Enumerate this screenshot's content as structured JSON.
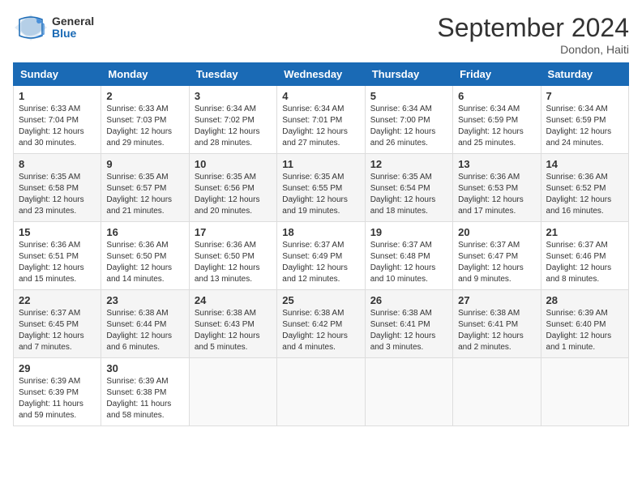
{
  "logo": {
    "general": "General",
    "blue": "Blue"
  },
  "title": "September 2024",
  "location": "Dondon, Haiti",
  "days_of_week": [
    "Sunday",
    "Monday",
    "Tuesday",
    "Wednesday",
    "Thursday",
    "Friday",
    "Saturday"
  ],
  "weeks": [
    [
      {
        "day": "1",
        "info": "Sunrise: 6:33 AM\nSunset: 7:04 PM\nDaylight: 12 hours and 30 minutes."
      },
      {
        "day": "2",
        "info": "Sunrise: 6:33 AM\nSunset: 7:03 PM\nDaylight: 12 hours and 29 minutes."
      },
      {
        "day": "3",
        "info": "Sunrise: 6:34 AM\nSunset: 7:02 PM\nDaylight: 12 hours and 28 minutes."
      },
      {
        "day": "4",
        "info": "Sunrise: 6:34 AM\nSunset: 7:01 PM\nDaylight: 12 hours and 27 minutes."
      },
      {
        "day": "5",
        "info": "Sunrise: 6:34 AM\nSunset: 7:00 PM\nDaylight: 12 hours and 26 minutes."
      },
      {
        "day": "6",
        "info": "Sunrise: 6:34 AM\nSunset: 6:59 PM\nDaylight: 12 hours and 25 minutes."
      },
      {
        "day": "7",
        "info": "Sunrise: 6:34 AM\nSunset: 6:59 PM\nDaylight: 12 hours and 24 minutes."
      }
    ],
    [
      {
        "day": "8",
        "info": "Sunrise: 6:35 AM\nSunset: 6:58 PM\nDaylight: 12 hours and 23 minutes."
      },
      {
        "day": "9",
        "info": "Sunrise: 6:35 AM\nSunset: 6:57 PM\nDaylight: 12 hours and 21 minutes."
      },
      {
        "day": "10",
        "info": "Sunrise: 6:35 AM\nSunset: 6:56 PM\nDaylight: 12 hours and 20 minutes."
      },
      {
        "day": "11",
        "info": "Sunrise: 6:35 AM\nSunset: 6:55 PM\nDaylight: 12 hours and 19 minutes."
      },
      {
        "day": "12",
        "info": "Sunrise: 6:35 AM\nSunset: 6:54 PM\nDaylight: 12 hours and 18 minutes."
      },
      {
        "day": "13",
        "info": "Sunrise: 6:36 AM\nSunset: 6:53 PM\nDaylight: 12 hours and 17 minutes."
      },
      {
        "day": "14",
        "info": "Sunrise: 6:36 AM\nSunset: 6:52 PM\nDaylight: 12 hours and 16 minutes."
      }
    ],
    [
      {
        "day": "15",
        "info": "Sunrise: 6:36 AM\nSunset: 6:51 PM\nDaylight: 12 hours and 15 minutes."
      },
      {
        "day": "16",
        "info": "Sunrise: 6:36 AM\nSunset: 6:50 PM\nDaylight: 12 hours and 14 minutes."
      },
      {
        "day": "17",
        "info": "Sunrise: 6:36 AM\nSunset: 6:50 PM\nDaylight: 12 hours and 13 minutes."
      },
      {
        "day": "18",
        "info": "Sunrise: 6:37 AM\nSunset: 6:49 PM\nDaylight: 12 hours and 12 minutes."
      },
      {
        "day": "19",
        "info": "Sunrise: 6:37 AM\nSunset: 6:48 PM\nDaylight: 12 hours and 10 minutes."
      },
      {
        "day": "20",
        "info": "Sunrise: 6:37 AM\nSunset: 6:47 PM\nDaylight: 12 hours and 9 minutes."
      },
      {
        "day": "21",
        "info": "Sunrise: 6:37 AM\nSunset: 6:46 PM\nDaylight: 12 hours and 8 minutes."
      }
    ],
    [
      {
        "day": "22",
        "info": "Sunrise: 6:37 AM\nSunset: 6:45 PM\nDaylight: 12 hours and 7 minutes."
      },
      {
        "day": "23",
        "info": "Sunrise: 6:38 AM\nSunset: 6:44 PM\nDaylight: 12 hours and 6 minutes."
      },
      {
        "day": "24",
        "info": "Sunrise: 6:38 AM\nSunset: 6:43 PM\nDaylight: 12 hours and 5 minutes."
      },
      {
        "day": "25",
        "info": "Sunrise: 6:38 AM\nSunset: 6:42 PM\nDaylight: 12 hours and 4 minutes."
      },
      {
        "day": "26",
        "info": "Sunrise: 6:38 AM\nSunset: 6:41 PM\nDaylight: 12 hours and 3 minutes."
      },
      {
        "day": "27",
        "info": "Sunrise: 6:38 AM\nSunset: 6:41 PM\nDaylight: 12 hours and 2 minutes."
      },
      {
        "day": "28",
        "info": "Sunrise: 6:39 AM\nSunset: 6:40 PM\nDaylight: 12 hours and 1 minute."
      }
    ],
    [
      {
        "day": "29",
        "info": "Sunrise: 6:39 AM\nSunset: 6:39 PM\nDaylight: 11 hours and 59 minutes."
      },
      {
        "day": "30",
        "info": "Sunrise: 6:39 AM\nSunset: 6:38 PM\nDaylight: 11 hours and 58 minutes."
      },
      {
        "day": "",
        "info": ""
      },
      {
        "day": "",
        "info": ""
      },
      {
        "day": "",
        "info": ""
      },
      {
        "day": "",
        "info": ""
      },
      {
        "day": "",
        "info": ""
      }
    ]
  ]
}
